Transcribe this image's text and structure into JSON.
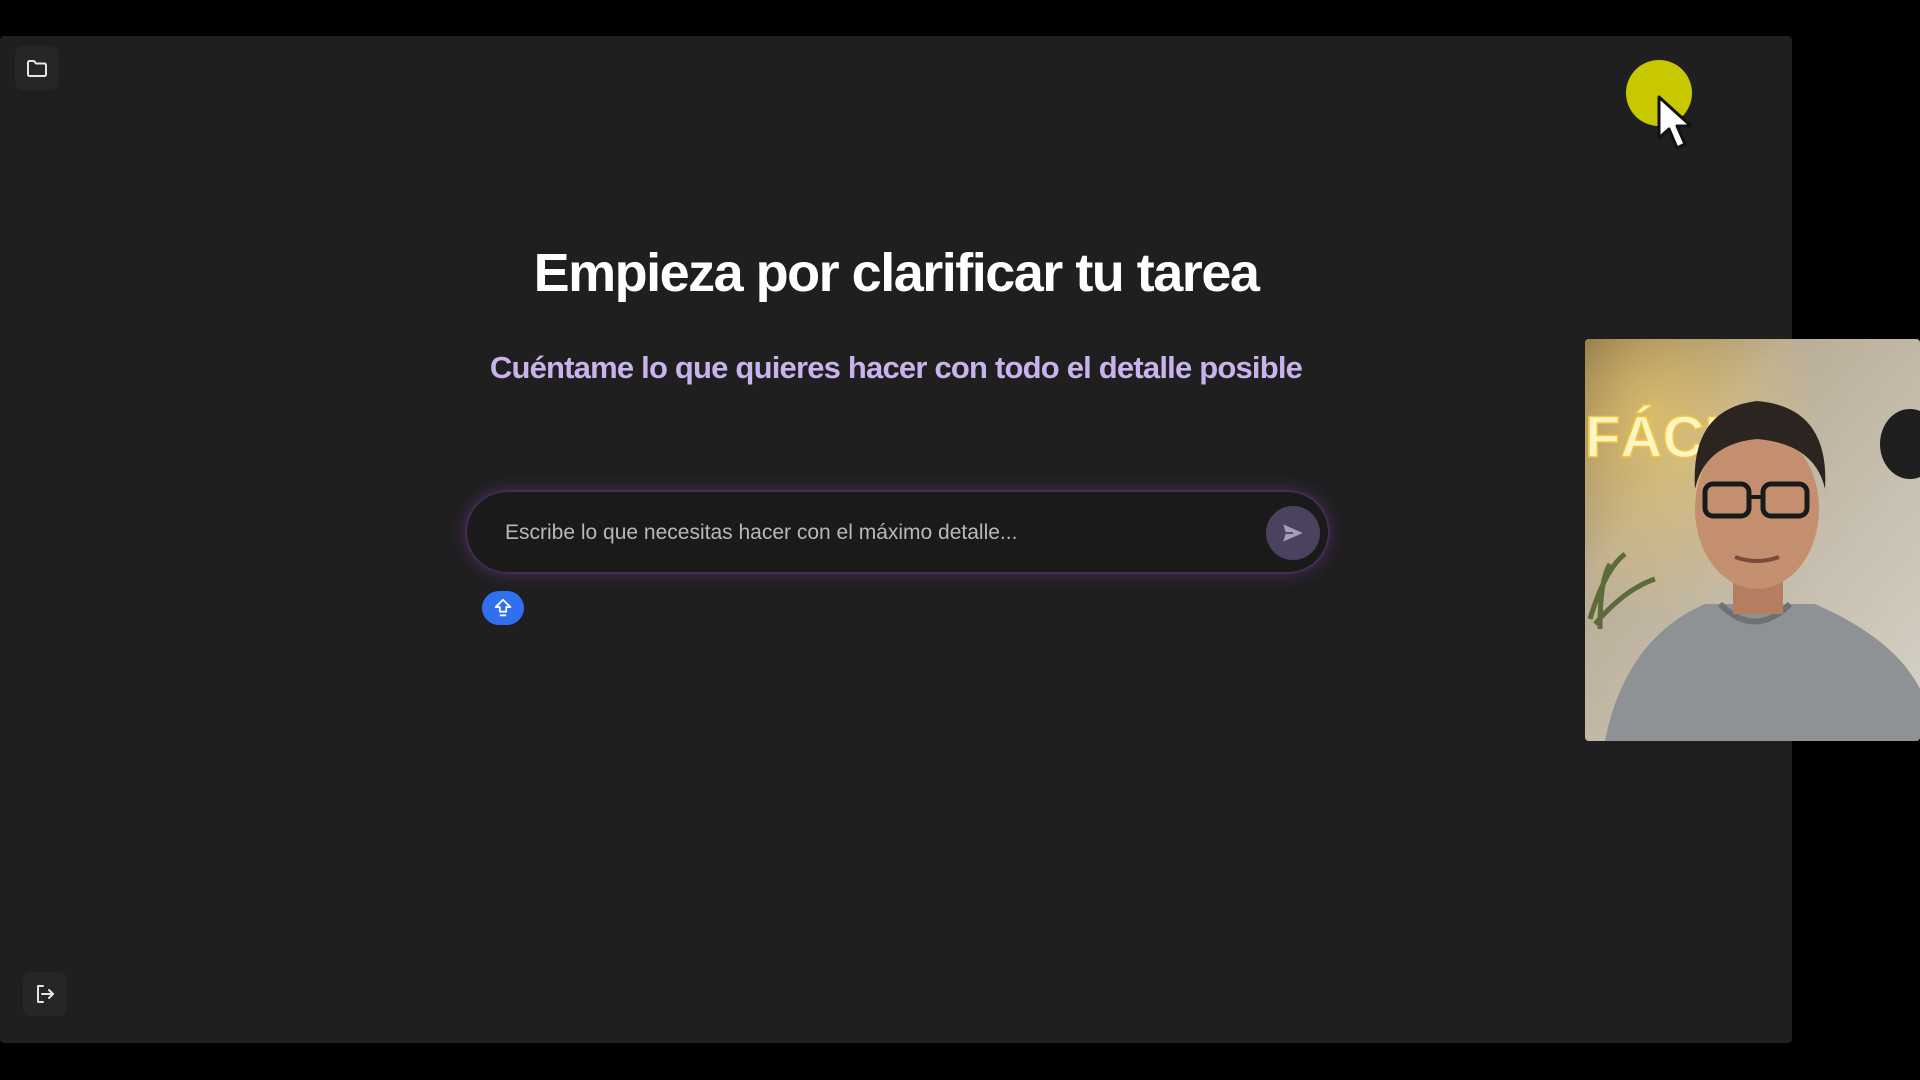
{
  "header": {
    "folder_icon": "folder-icon"
  },
  "main": {
    "title": "Empieza por clarificar tu tarea",
    "subtitle": "Cuéntame lo que quieres hacer con todo el detalle posible"
  },
  "composer": {
    "placeholder": "Escribe lo que necesitas hacer con el máximo detalle...",
    "value": "",
    "send_icon": "send-icon",
    "upload_icon": "upload-icon"
  },
  "footer": {
    "logout_icon": "logout-icon"
  },
  "overlay": {
    "webcam_sign_text": "FÁCIL"
  },
  "colors": {
    "background": "#1f1f1f",
    "title": "#ffffff",
    "subtitle": "#c9b3ec",
    "send_button": "#4c4260",
    "upload_badge": "#2f6ff0",
    "cursor_highlight": "#c8c800"
  }
}
